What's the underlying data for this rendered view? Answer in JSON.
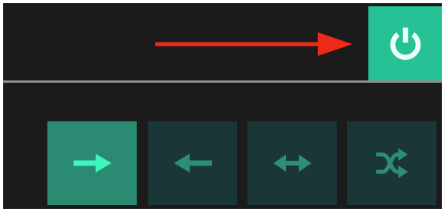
{
  "colors": {
    "panel_background": "#1b1b1b",
    "power_button_background": "#27c196",
    "power_icon": "#e9fff8",
    "annotation_arrow": "#f02a18",
    "divider": "#8c8c8c",
    "mode_button_active_background": "#2b8a72",
    "mode_button_active_icon": "#3ff5be",
    "mode_button_inactive_background": "#1b3636",
    "mode_button_inactive_icon": "#2c8d79"
  },
  "power_button": {
    "icon": "power-icon",
    "state": "on"
  },
  "mode_buttons": [
    {
      "icon": "arrow-right-icon",
      "active": true
    },
    {
      "icon": "arrow-left-icon",
      "active": false
    },
    {
      "icon": "arrow-left-right-icon",
      "active": false
    },
    {
      "icon": "shuffle-icon",
      "active": false
    }
  ]
}
